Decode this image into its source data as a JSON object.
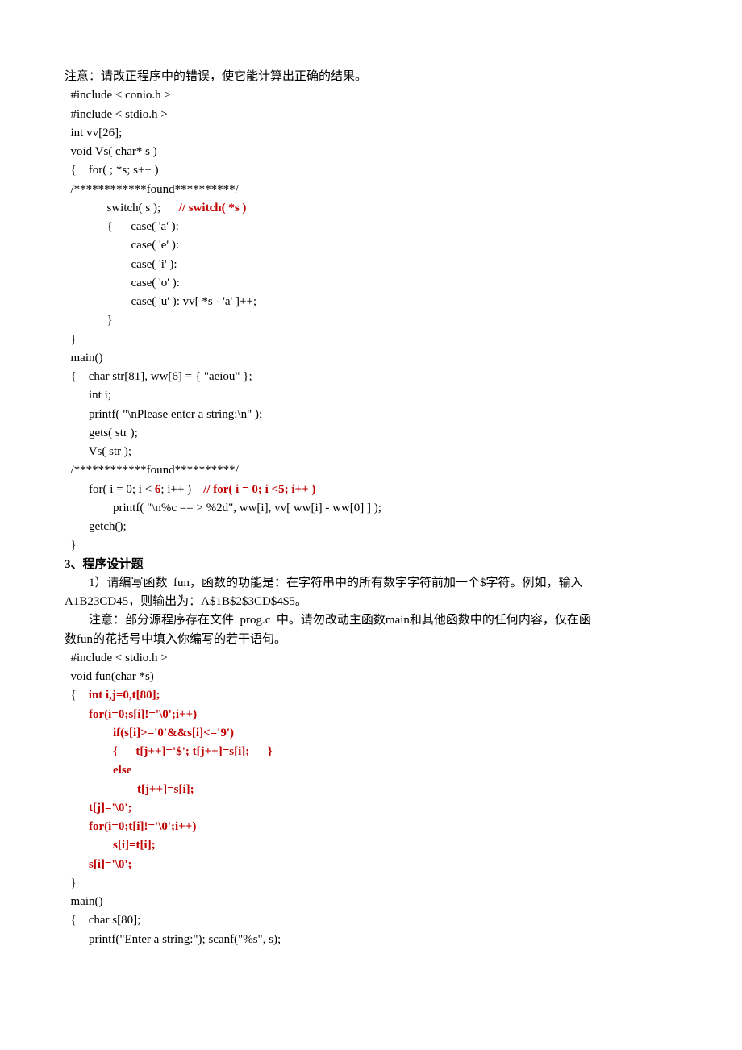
{
  "lines": [
    {
      "segs": [
        {
          "t": "注意：请改正程序中的错误，使它能计算出正确的结果。"
        }
      ]
    },
    {
      "segs": [
        {
          "t": "  #include < conio.h >"
        }
      ]
    },
    {
      "segs": [
        {
          "t": "  #include < stdio.h >"
        }
      ]
    },
    {
      "segs": [
        {
          "t": "  int vv[26];"
        }
      ]
    },
    {
      "segs": [
        {
          "t": "  void Vs( char* s )"
        }
      ]
    },
    {
      "segs": [
        {
          "t": "  {    for( ; *s; s++ )"
        }
      ]
    },
    {
      "segs": [
        {
          "t": "  /************found**********/"
        }
      ]
    },
    {
      "segs": [
        {
          "t": "              switch( s );      "
        },
        {
          "t": "// switch( *s )",
          "class": "red bold"
        }
      ]
    },
    {
      "segs": [
        {
          "t": "              {      case( 'a' ):"
        }
      ]
    },
    {
      "segs": [
        {
          "t": "                      case( 'e' ):"
        }
      ]
    },
    {
      "segs": [
        {
          "t": "                      case( 'i' ):"
        }
      ]
    },
    {
      "segs": [
        {
          "t": "                      case( 'o' ):"
        }
      ]
    },
    {
      "segs": [
        {
          "t": "                      case( 'u' ): vv[ *s - 'a' ]++;"
        }
      ]
    },
    {
      "segs": [
        {
          "t": "              }"
        }
      ]
    },
    {
      "segs": [
        {
          "t": "  }"
        }
      ]
    },
    {
      "segs": [
        {
          "t": "  main()"
        }
      ]
    },
    {
      "segs": [
        {
          "t": "  {    char str[81], ww[6] = { \"aeiou\" };"
        }
      ]
    },
    {
      "segs": [
        {
          "t": "        int i;"
        }
      ]
    },
    {
      "segs": [
        {
          "t": "        printf( \"\\nPlease enter a string:\\n\" );"
        }
      ]
    },
    {
      "segs": [
        {
          "t": "        gets( str );"
        }
      ]
    },
    {
      "segs": [
        {
          "t": "        Vs( str );"
        }
      ]
    },
    {
      "segs": [
        {
          "t": "  /************found**********/"
        }
      ]
    },
    {
      "segs": [
        {
          "t": "        for( i = 0; i < "
        },
        {
          "t": "6",
          "class": "red bold"
        },
        {
          "t": "; i++ )    "
        },
        {
          "t": "// for( i = 0; i <5; i++ )",
          "class": "red bold"
        }
      ]
    },
    {
      "segs": [
        {
          "t": "                printf( \"\\n%c == > %2d\", ww[i], vv[ ww[i] - ww[0] ] );"
        }
      ]
    },
    {
      "segs": [
        {
          "t": "        getch();"
        }
      ]
    },
    {
      "segs": [
        {
          "t": "  }"
        }
      ]
    },
    {
      "segs": [
        {
          "t": "3、程序设计题",
          "class": "bold"
        }
      ]
    },
    {
      "segs": [
        {
          "t": "        1）请编写函数  fun，函数的功能是：在字符串中的所有数字字符前加一个$字符。例如，输入"
        }
      ]
    },
    {
      "segs": [
        {
          "t": "A1B23CD45，则输出为：A$1B$2$3CD$4$5。"
        }
      ]
    },
    {
      "segs": [
        {
          "t": "        注意：部分源程序存在文件  prog.c  中。请勿改动主函数main和其他函数中的任何内容，仅在函"
        }
      ]
    },
    {
      "segs": [
        {
          "t": "数fun的花括号中填入你编写的若干语句。"
        }
      ]
    },
    {
      "segs": [
        {
          "t": "  #include < stdio.h >"
        }
      ]
    },
    {
      "segs": [
        {
          "t": "  void fun(char *s)"
        }
      ]
    },
    {
      "segs": [
        {
          "t": "  {    "
        },
        {
          "t": "int i,j=0,t[80];",
          "class": "red bold"
        }
      ]
    },
    {
      "segs": [
        {
          "t": "        "
        },
        {
          "t": "for(i=0;s[i]!='\\0';i++)",
          "class": "red bold"
        }
      ]
    },
    {
      "segs": [
        {
          "t": "                "
        },
        {
          "t": "if(s[i]>='0'&&s[i]<='9')",
          "class": "red bold"
        }
      ]
    },
    {
      "segs": [
        {
          "t": "                "
        },
        {
          "t": "{      t[j++]='$'; t[j++]=s[i];      }",
          "class": "red bold"
        }
      ]
    },
    {
      "segs": [
        {
          "t": "                "
        },
        {
          "t": "else",
          "class": "red bold"
        }
      ]
    },
    {
      "segs": [
        {
          "t": "                        "
        },
        {
          "t": "t[j++]=s[i];",
          "class": "red bold"
        }
      ]
    },
    {
      "segs": [
        {
          "t": "        "
        },
        {
          "t": "t[j]='\\0';",
          "class": "red bold"
        }
      ]
    },
    {
      "segs": [
        {
          "t": "        "
        },
        {
          "t": "for(i=0;t[i]!='\\0';i++)",
          "class": "red bold"
        }
      ]
    },
    {
      "segs": [
        {
          "t": "                "
        },
        {
          "t": "s[i]=t[i];",
          "class": "red bold"
        }
      ]
    },
    {
      "segs": [
        {
          "t": "        "
        },
        {
          "t": "s[i]='\\0';",
          "class": "red bold"
        }
      ]
    },
    {
      "segs": [
        {
          "t": "  }"
        }
      ]
    },
    {
      "segs": [
        {
          "t": "  main()"
        }
      ]
    },
    {
      "segs": [
        {
          "t": "  {    char s[80];"
        }
      ]
    },
    {
      "segs": [
        {
          "t": "        printf(\"Enter a string:\"); scanf(\"%s\", s);"
        }
      ]
    }
  ]
}
